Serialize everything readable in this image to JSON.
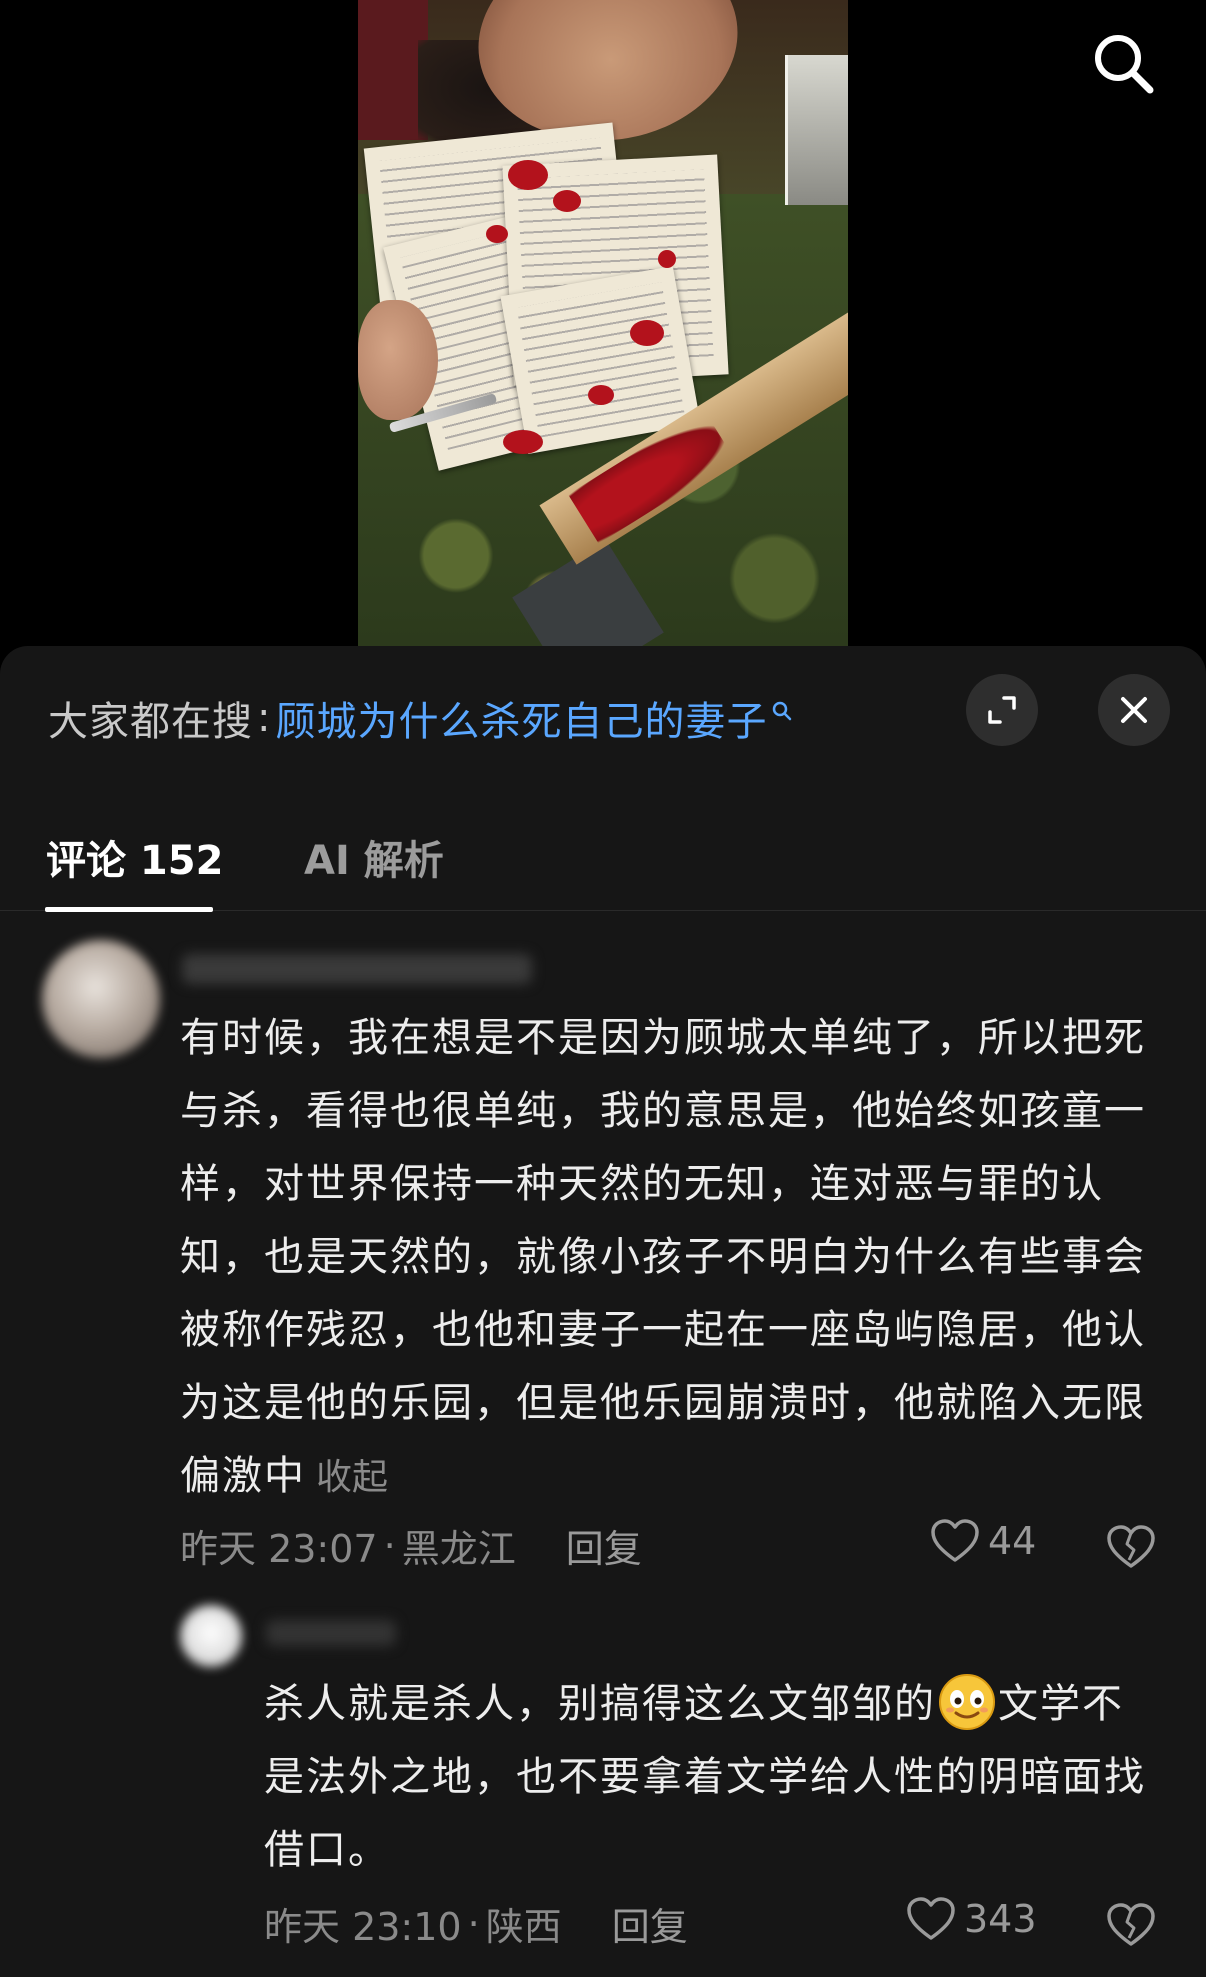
{
  "video": {
    "search_icon": "search-icon"
  },
  "hot_search": {
    "prefix": "大家都在搜",
    "colon": ":",
    "query": "顾城为什么杀死自己的妻子",
    "query_icon": "search-small-icon",
    "query_color": "#5aa7ff"
  },
  "controls": {
    "expand_icon": "expand-icon",
    "close_icon": "close-icon"
  },
  "tabs": [
    {
      "label": "评论 152",
      "active": true
    },
    {
      "label": "AI 解析",
      "active": false
    }
  ],
  "comments": [
    {
      "text": "有时候，我在想是不是因为顾城太单纯了，所以把死与杀，看得也很单纯，我的意思是，他始终如孩童一样，对世界保持一种天然的无知，连对恶与罪的认知，也是天然的，就像小孩子不明白为什么有些事会被称作残忍，也他和妻子一起在一座岛屿隐居，他认为这是他的乐园，但是他乐园崩溃时，他就陷入无限偏激中",
      "collapse_label": "收起",
      "time": "昨天 23:07",
      "dot": "·",
      "region": "黑龙江",
      "reply_label": "回复",
      "likes": "44"
    },
    {
      "text_before_emoji": "杀人就是杀人，别搞得这么文邹邹的",
      "emoji": "grinning-face-emoji",
      "text_after_emoji": "文学不是法外之地，也不要拿着文学给人性的阴暗面找借口。",
      "time": "昨天 23:10",
      "dot": "·",
      "region": "陕西",
      "reply_label": "回复",
      "likes": "343"
    }
  ],
  "colors": {
    "sheet_bg": "#161616",
    "accent_link": "#5aa7ff",
    "muted_text": "#8a8a8a"
  }
}
